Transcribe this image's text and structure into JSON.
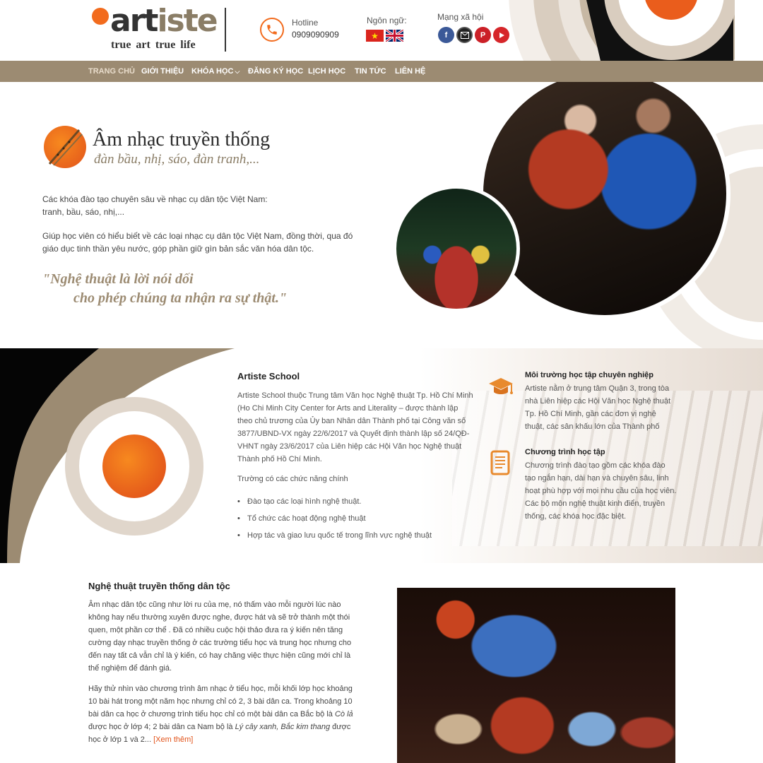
{
  "brand": {
    "logo_word_a": "art",
    "logo_word_b": "iste",
    "tagline": "true art  true life",
    "accent_color": "#f26b1d",
    "brand_color": "#9c8b72"
  },
  "header": {
    "hotline_label": "Hotline",
    "hotline_number": "0909090909",
    "language_label": "Ngôn ngữ:",
    "languages": [
      "vietnam-flag-icon",
      "uk-flag-icon"
    ],
    "social_label": "Mạng xã hội",
    "social": [
      "facebook-icon",
      "email-icon",
      "pinterest-icon",
      "youtube-icon"
    ]
  },
  "nav": {
    "items": [
      {
        "label": "TRANG CHỦ"
      },
      {
        "label": "GIỚI THIỆU"
      },
      {
        "label": "KHÓA HỌC"
      },
      {
        "label": "ĐĂNG KÝ HỌC"
      },
      {
        "label": "LỊCH HỌC"
      },
      {
        "label": "TIN TỨC"
      },
      {
        "label": "LIÊN HỆ"
      }
    ]
  },
  "hero": {
    "title": "Âm nhạc truyền thống",
    "subtitle": "đàn bầu, nhị, sáo, đàn tranh,...",
    "para1_line1": "Các khóa đào tạo chuyên sâu về nhạc cụ dân tộc Việt Nam:",
    "para1_line2": "tranh, bầu, sáo, nhị,...",
    "para2": "Giúp học viên có hiểu biết về các loại nhạc cụ dân tộc Việt Nam, đồng thời, qua đó giáo dục tinh thần yêu nước, góp phần giữ gìn bản sắc văn hóa dân tộc.",
    "quote_line1": "\"Nghệ thuật là lời nói dối",
    "quote_line2": "cho phép chúng ta nhận ra sự thật.\""
  },
  "about": {
    "title": "Artiste School",
    "description": "Artiste School thuộc Trung tâm Văn học Nghệ thuật Tp. Hồ Chí Minh (Ho Chi Minh City Center for Arts and Literality – được thành lập theo chủ trương của Ủy ban Nhân dân Thành phố tại Công văn số 3877/UBND-VX ngày 22/6/2017 và Quyết định thành lập số 24/QĐ-VHNT ngày 23/6/2017 của Liên hiệp các Hội Văn học Nghệ thuật Thành phố Hồ Chí Minh.",
    "functions_intro": "Trường có các chức năng chính",
    "functions": [
      "Đào tạo các loại hình nghệ thuật.",
      "Tổ chức các hoạt động nghệ thuật",
      "Hợp tác và giao lưu quốc tế trong lĩnh vực nghệ thuật"
    ],
    "features": [
      {
        "icon": "graduation-cap-icon",
        "title": "Môi trường học tập chuyên nghiệp",
        "text": "Artiste nằm ở trung tâm Quận 3, trong tòa nhà Liên hiệp các Hội Văn học Nghệ thuật Tp. Hồ Chí Minh, gần các đơn vị nghệ thuật, các sân khấu lớn của Thành phố"
      },
      {
        "icon": "document-list-icon",
        "title": "Chương trình học tập",
        "text": "Chương trình đào tạo gồm các khóa đào tạo ngắn hạn, dài hạn và chuyên sâu, linh hoạt phù hợp với mọi nhu cầu của học viên.",
        "text2": "Các bộ môn nghệ thuật kinh điển, truyền thống, các khóa học đặc biệt."
      }
    ]
  },
  "article": {
    "title": "Nghệ thuật truyền thống dân tộc",
    "para1": "Âm nhạc dân tộc cũng như lời ru của mẹ, nó thấm vào mỗi người lúc nào không hay nếu thường xuyên được nghe, được hát và sẽ trở thành một thói quen, một phần cơ thể . Đã có nhiều cuộc hội thảo đưa ra ý kiến nên tăng cường dạy nhạc truyền thống ở các trường tiểu học và trung học nhưng cho đến nay tất cả vẫn chỉ là ý kiến, có hay chăng việc thực hiện cũng mới chỉ là thể nghiệm để đánh giá.",
    "para2_a": "Hãy thử nhìn vào chương trình âm nhạc ở tiểu học, mỗi khối lớp học khoảng 10 bài hát trong một năm học nhưng chỉ có 2, 3 bài dân ca. Trong khoảng 10 bài dân ca học ở chương trình tiểu học chỉ có một bài dân ca Bắc bộ là ",
    "para2_song1": "Cò lả",
    "para2_b": " được học ở lớp 4; 2 bài dân ca Nam bộ là ",
    "para2_song2": "Lý cây xanh, Bắc kim thang",
    "para2_c": " được học ở lớp 1 và 2... ",
    "read_more": "[Xem thêm]"
  }
}
